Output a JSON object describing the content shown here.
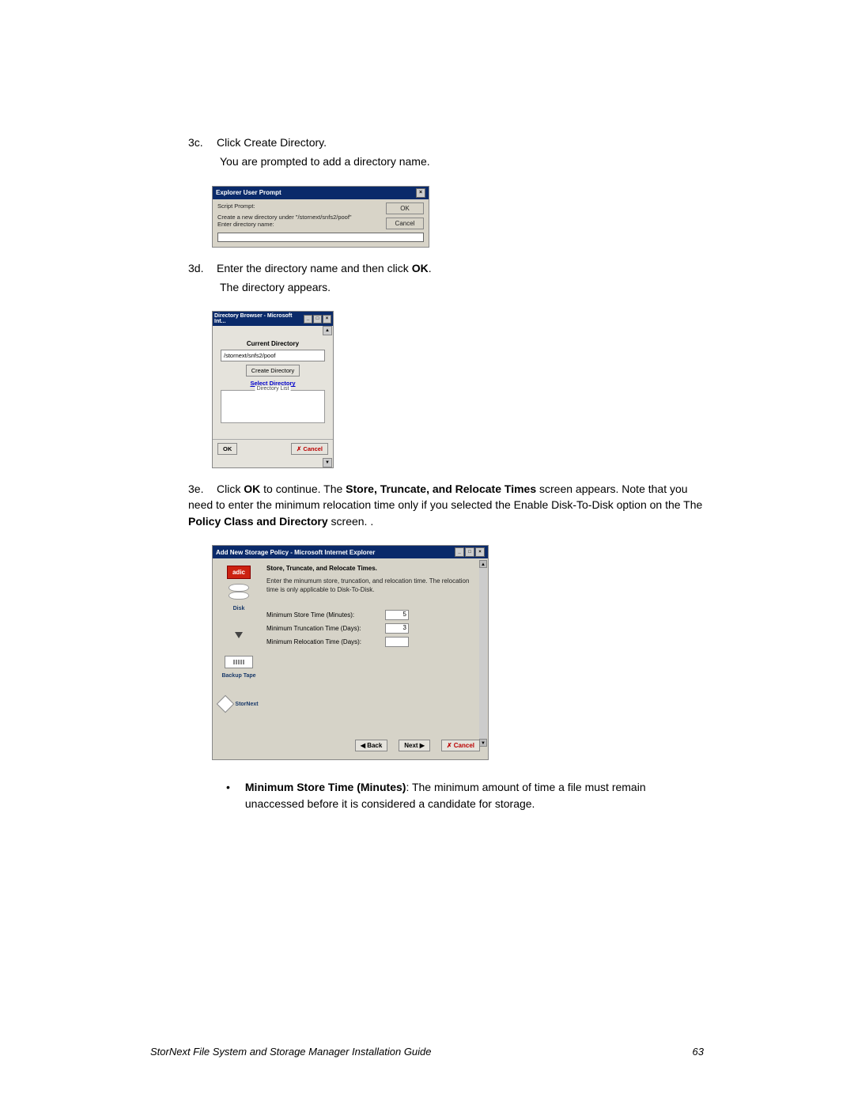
{
  "steps": {
    "s3c": {
      "num": "3c.",
      "line1": "Click Create Directory.",
      "line2": "You are prompted to add a directory name."
    },
    "s3d": {
      "num": "3d.",
      "line1_pre": "Enter the directory name and then click ",
      "line1_bold": "OK",
      "line1_post": ".",
      "line2": "The directory appears."
    },
    "s3e": {
      "num": "3e.",
      "pre1": "Click ",
      "b1": "OK",
      "mid1": " to continue. The ",
      "b2": "Store, Truncate, and Relocate Times",
      "mid2": " screen appears. Note that you need to enter the minimum relocation time only if you selected the Enable Disk-To-Disk option on the The ",
      "b3": "Policy Class and Directory",
      "post": " screen. ."
    }
  },
  "prompt1": {
    "title": "Explorer User Prompt",
    "script_prompt": "Script Prompt:",
    "msg1": "Create a new directory under \"/stornext/snfs2/poof\"",
    "msg2": "Enter directory name:",
    "ok": "OK",
    "cancel": "Cancel"
  },
  "browser": {
    "title": "Directory Browser - Microsoft Int...",
    "current_dir_label": "Current Directory",
    "current_dir_value": "/stornext/snfs2/poof",
    "create_btn": "Create Directory",
    "select_link": "Select Directory",
    "list_label": "Directory List",
    "ok": "OK",
    "cancel": "✗ Cancel"
  },
  "policy": {
    "title": "Add New Storage Policy - Microsoft Internet Explorer",
    "section": "Store, Truncate, and Relocate Times.",
    "desc": "Enter the minumum store, truncation, and relocation time. The relocation time is only applicable to Disk-To-Disk.",
    "row1_label": "Minimum Store Time (Minutes):",
    "row1_val": "5",
    "row2_label": "Minimum Truncation Time (Days):",
    "row2_val": "3",
    "row3_label": "Minimum Relocation Time (Days):",
    "row3_val": "",
    "side": {
      "adic": "adic",
      "disk": "Disk",
      "tape": "Backup Tape",
      "stornext": "StorNext"
    },
    "back": "◀  Back",
    "next": "Next  ▶",
    "cancel": "✗ Cancel"
  },
  "bullet": {
    "bold": "Minimum Store Time (Minutes)",
    "text": ": The minimum amount of time a file must remain unaccessed before it is considered a candidate for storage."
  },
  "footer": {
    "title": "StorNext File System and Storage Manager Installation Guide",
    "page": "63"
  }
}
